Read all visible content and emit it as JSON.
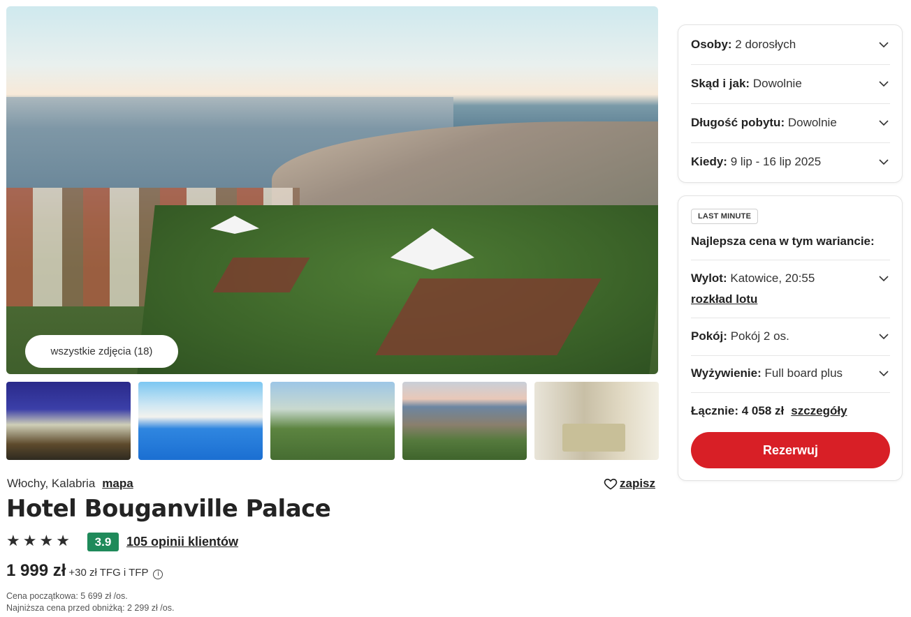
{
  "gallery": {
    "all_photos_label": "wszystkie zdjęcia (18)"
  },
  "hotel": {
    "location": "Włochy, Kalabria",
    "map_link": "mapa",
    "save_label": "zapisz",
    "name": "Hotel Bouganville Palace",
    "stars": 4,
    "rating": "3.9",
    "reviews_label": "105 opinii klientów",
    "price": "1 999 zł",
    "price_extra": "+30 zł TFG i TFP",
    "initial_price": "Cena początkowa: 5 699 zł /os.",
    "lowest_before_discount": "Najniższa cena przed obniżką: 2 299 zł /os."
  },
  "search": {
    "people": {
      "label": "Osoby:",
      "value": "2 dorosłych"
    },
    "from": {
      "label": "Skąd i jak:",
      "value": "Dowolnie"
    },
    "length": {
      "label": "Długość pobytu:",
      "value": "Dowolnie"
    },
    "when": {
      "label": "Kiedy:",
      "value": "9 lip - 16 lip 2025"
    }
  },
  "offer": {
    "badge": "LAST MINUTE",
    "heading": "Najlepsza cena w tym wariancie:",
    "flight": {
      "label": "Wylot:",
      "value": "Katowice, 20:55",
      "link": "rozkład lotu"
    },
    "room": {
      "label": "Pokój:",
      "value": "Pokój 2 os."
    },
    "board": {
      "label": "Wyżywienie:",
      "value": "Full board plus"
    },
    "total": {
      "label": "Łącznie: 4 058 zł",
      "link": "szczegóły"
    },
    "book_label": "Rezerwuj"
  },
  "colors": {
    "accent": "#d81f26",
    "rating": "#1f8a5a"
  }
}
